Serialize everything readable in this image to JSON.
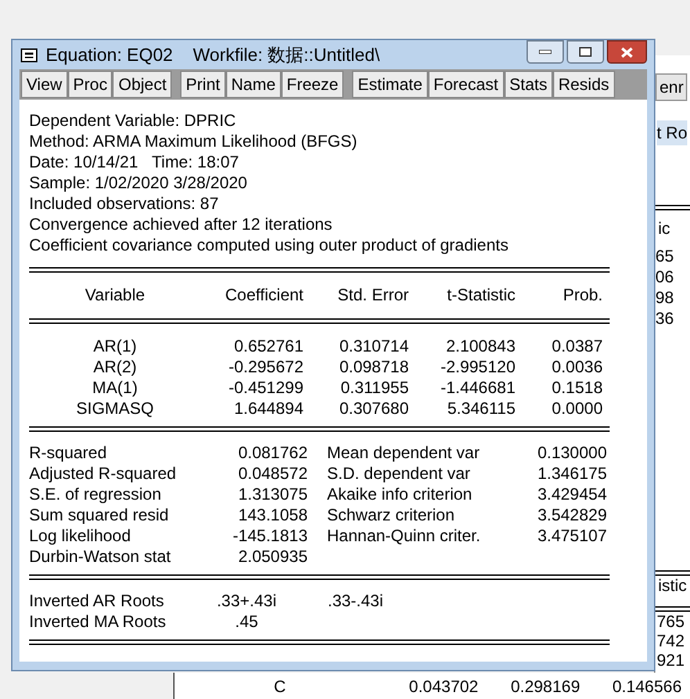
{
  "window": {
    "title": "Equation: EQ02",
    "workfile": "Workfile: 数据::Untitled\\"
  },
  "toolbar": [
    [
      "View",
      "Proc",
      "Object"
    ],
    [
      "Print",
      "Name",
      "Freeze"
    ],
    [
      "Estimate",
      "Forecast",
      "Stats",
      "Resids"
    ]
  ],
  "header_lines": [
    "Dependent Variable: DPRIC",
    "Method: ARMA Maximum Likelihood (BFGS)",
    "Date: 10/14/21   Time: 18:07",
    "Sample: 1/02/2020 3/28/2020",
    "Included observations: 87",
    "Convergence achieved after 12 iterations",
    "Coefficient covariance computed using outer product of gradients"
  ],
  "table": {
    "columns": [
      "Variable",
      "Coefficient",
      "Std. Error",
      "t-Statistic",
      "Prob."
    ],
    "rows": [
      [
        "AR(1)",
        "0.652761",
        "0.310714",
        "2.100843",
        "0.0387"
      ],
      [
        "AR(2)",
        "-0.295672",
        "0.098718",
        "-2.995120",
        "0.0036"
      ],
      [
        "MA(1)",
        "-0.451299",
        "0.311955",
        "-1.446681",
        "0.1518"
      ],
      [
        "SIGMASQ",
        "1.644894",
        "0.307680",
        "5.346115",
        "0.0000"
      ]
    ]
  },
  "statistics": [
    {
      "label": "R-squared",
      "value": "0.081762",
      "label_2": "Mean dependent var",
      "value_2": "0.130000"
    },
    {
      "label": "Adjusted R-squared",
      "value": "0.048572",
      "label_2": "S.D. dependent var",
      "value_2": "1.346175"
    },
    {
      "label": "S.E. of regression",
      "value": "1.313075",
      "label_2": "Akaike info criterion",
      "value_2": "3.429454"
    },
    {
      "label": "Sum squared resid",
      "value": "143.1058",
      "label_2": "Schwarz criterion",
      "value_2": "3.542829"
    },
    {
      "label": "Log likelihood",
      "value": "-145.1813",
      "label_2": "Hannan-Quinn criter.",
      "value_2": "3.475107"
    },
    {
      "label": "Durbin-Watson stat",
      "value": "2.050935"
    }
  ],
  "roots": [
    {
      "label": "Inverted AR Roots",
      "values": [
        ".33+.43i",
        ".33-.43i"
      ]
    },
    {
      "label": "Inverted MA Roots",
      "values": [
        ".45"
      ]
    }
  ],
  "background": {
    "buttons": [
      "enr"
    ],
    "bar_text": "t Ro",
    "heading": "ic",
    "values": [
      "65",
      "06",
      "98",
      "36"
    ],
    "heading_2": "istic",
    "values_2": [
      "765",
      "742",
      "921"
    ],
    "bottom_row": [
      "C",
      "0.043702",
      "0.298169",
      "0.146566"
    ]
  }
}
